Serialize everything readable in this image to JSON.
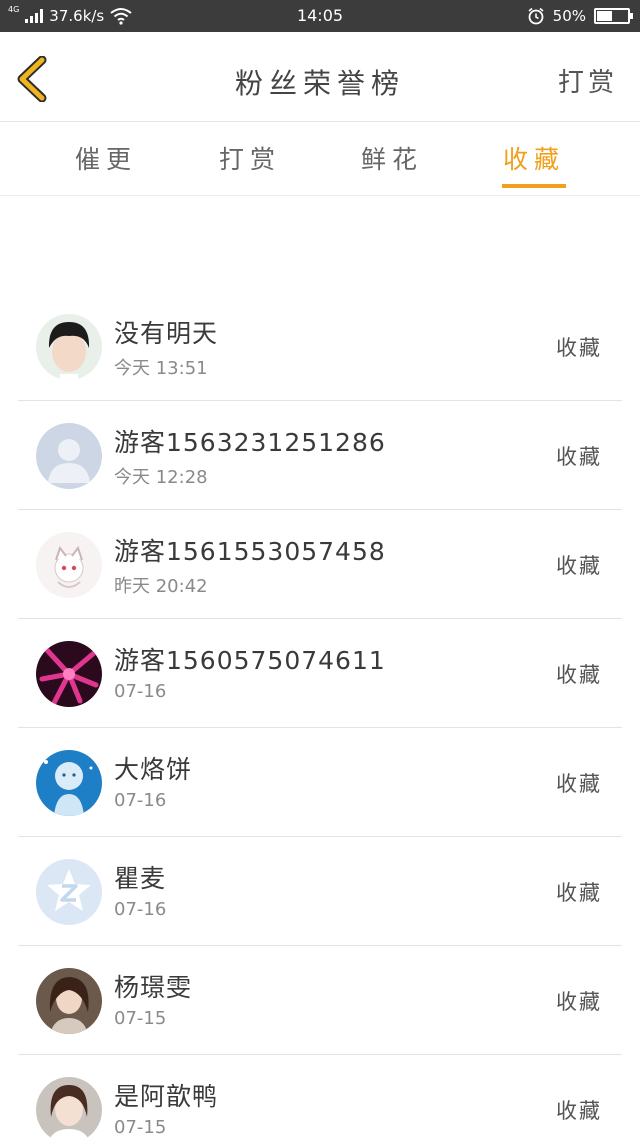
{
  "status_bar": {
    "network_type": "4G",
    "speed": "37.6k/s",
    "time": "14:05",
    "battery": "50%",
    "battery_level": 0.5
  },
  "header": {
    "title": "粉丝荣誉榜",
    "action_label": "打赏"
  },
  "tabs": [
    {
      "label": "催更",
      "active": false
    },
    {
      "label": "打赏",
      "active": false
    },
    {
      "label": "鲜花",
      "active": false
    },
    {
      "label": "收藏",
      "active": true
    }
  ],
  "colors": {
    "accent": "#f0a01c",
    "back_icon": "#f0b41e",
    "status_bar": "#3c3c3c"
  },
  "list": [
    {
      "name": "没有明天",
      "time": "今天 13:51",
      "action": "收藏",
      "avatar": "boy-photo"
    },
    {
      "name": "游客1563231251286",
      "time": "今天 12:28",
      "action": "收藏",
      "avatar": "default-person"
    },
    {
      "name": "游客1561553057458",
      "time": "昨天 20:42",
      "action": "收藏",
      "avatar": "anime-girl"
    },
    {
      "name": "游客1560575074611",
      "time": "07-16",
      "action": "收藏",
      "avatar": "pink-flower"
    },
    {
      "name": "大烙饼",
      "time": "07-16",
      "action": "收藏",
      "avatar": "blue-illustration"
    },
    {
      "name": "瞿麦",
      "time": "07-16",
      "action": "收藏",
      "avatar": "qq-logo"
    },
    {
      "name": "杨璟雯",
      "time": "07-15",
      "action": "收藏",
      "avatar": "woman-photo"
    },
    {
      "name": "是阿歆鸭",
      "time": "07-15",
      "action": "收藏",
      "avatar": "girl-photo"
    }
  ]
}
